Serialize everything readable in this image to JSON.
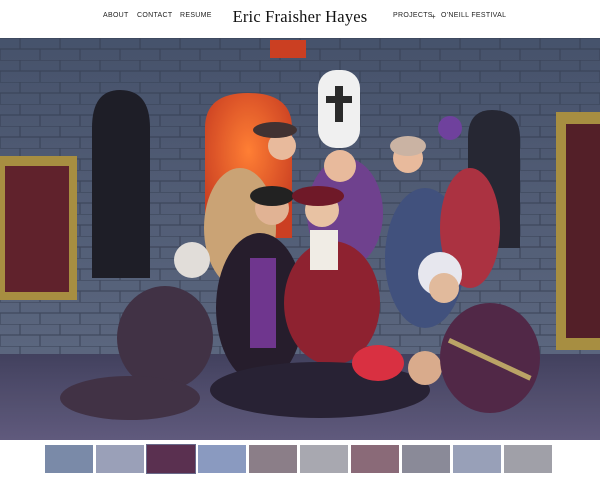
{
  "header": {
    "title": "Eric Fraisher Hayes",
    "nav_left": [
      "ABOUT",
      "CONTACT",
      "RESUME"
    ],
    "nav_right": [
      "PROJECTS",
      "O'NEILL FESTIVAL"
    ],
    "separator": "+"
  },
  "hero": {
    "alt": "stage production photo",
    "colors": {
      "stone": "#4a5670",
      "floor": "#4b4766",
      "door": "#e0461e",
      "window_frame": "#a48a3a",
      "window_inner": "#5a1a24"
    }
  },
  "thumbnails": {
    "count": 10,
    "active_index": 2,
    "colors": [
      "#7a8aa8",
      "#9aa0b8",
      "#5a3050",
      "#8a9ac0",
      "#8b7e88",
      "#a8a8b0",
      "#8a6a78",
      "#8a8a98",
      "#98a0b8",
      "#a0a0a8"
    ]
  }
}
